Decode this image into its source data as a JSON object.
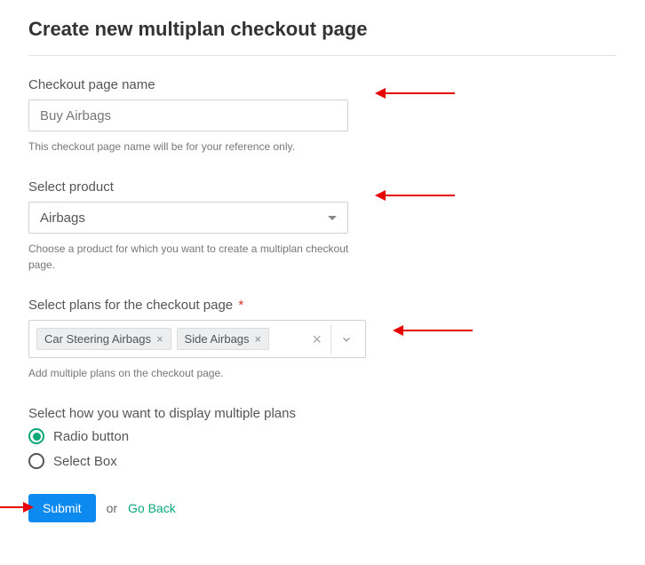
{
  "title": "Create new multiplan checkout page",
  "fields": {
    "name": {
      "label": "Checkout page name",
      "value": "Buy Airbags",
      "help": "This checkout page name will be for your reference only."
    },
    "product": {
      "label": "Select product",
      "value": "Airbags",
      "help": "Choose a product for which you want to create a multiplan checkout page."
    },
    "plans": {
      "label": "Select plans for the checkout page",
      "required_mark": "*",
      "chips": [
        "Car Steering Airbags",
        "Side Airbags"
      ],
      "help": "Add multiple plans on the checkout page."
    },
    "display": {
      "label": "Select how you want to display multiple plans",
      "options": [
        {
          "label": "Radio button",
          "checked": true
        },
        {
          "label": "Select Box",
          "checked": false
        }
      ]
    }
  },
  "actions": {
    "submit": "Submit",
    "or": "or",
    "go_back": "Go Back"
  }
}
